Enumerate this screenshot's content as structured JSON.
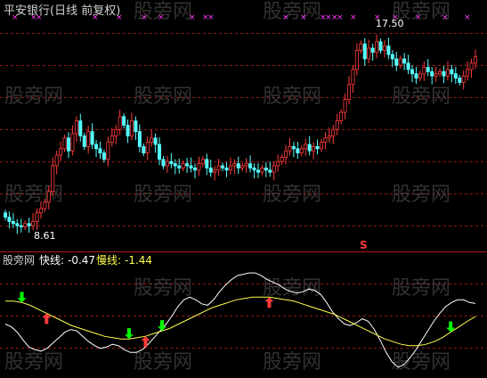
{
  "header": {
    "title": "平安银行(日线 前复权)"
  },
  "price_panel": {
    "high_label": "17.50",
    "low_label": "8.61",
    "marker_symbol": "S",
    "watermark": "股旁网"
  },
  "indicator_panel": {
    "name": "股旁网",
    "fast_label": "快线:",
    "fast_value": "-0.47",
    "slow_label": "慢线:",
    "slow_value": "-1.44"
  },
  "colors": {
    "background": "#000000",
    "up_candle": "#ff3b3b",
    "down_candle": "#54ffff",
    "grid": "#9b1414",
    "separator": "#b01a1a",
    "title": "#d0d0d0",
    "x_marks": "#ff3cff",
    "fast_line": "#ffffff",
    "slow_line": "#ffff4c",
    "buy_arrow": "#00ff00",
    "sell_arrow": "#ff3b3b",
    "watermark": "#5a5a5a"
  },
  "chart_data": [
    {
      "type": "candlestick",
      "title": "平安银行(日线 前复权)",
      "ylim": [
        8.0,
        18.5
      ],
      "annotations": [
        "17.50",
        "8.61"
      ],
      "close": [
        9.1,
        8.9,
        8.8,
        8.7,
        8.65,
        8.8,
        8.7,
        8.9,
        9.3,
        9.5,
        9.8,
        10.3,
        11.5,
        12.0,
        12.3,
        12.8,
        12.2,
        13.0,
        13.6,
        12.9,
        12.4,
        13.1,
        12.5,
        12.3,
        12.1,
        11.8,
        12.6,
        12.9,
        13.2,
        13.8,
        13.4,
        12.9,
        13.6,
        13.1,
        12.4,
        12.1,
        12.6,
        12.8,
        12.5,
        11.8,
        11.5,
        11.7,
        11.6,
        11.5,
        11.4,
        11.6,
        11.5,
        11.4,
        11.3,
        11.6,
        11.8,
        11.4,
        11.2,
        11.3,
        11.5,
        11.4,
        11.3,
        11.5,
        11.6,
        11.4,
        11.5,
        11.6,
        11.4,
        11.3,
        11.2,
        11.4,
        11.3,
        11.2,
        11.5,
        11.7,
        11.9,
        12.2,
        12.4,
        12.3,
        12.1,
        12.3,
        12.5,
        12.2,
        12.4,
        12.3,
        12.6,
        12.8,
        12.9,
        13.2,
        13.6,
        14.0,
        14.6,
        15.3,
        16.0,
        16.9,
        17.2,
        16.5,
        17.0,
        16.8,
        17.3,
        16.9,
        17.1,
        16.7,
        16.5,
        16.2,
        16.5,
        16.3,
        16.0,
        15.8,
        15.6,
        15.8,
        16.1,
        15.9,
        15.7,
        15.8,
        15.9,
        15.7,
        16.0,
        15.8,
        15.6,
        15.4,
        15.7,
        16.0,
        16.3,
        16.6
      ],
      "open": [
        9.3,
        9.1,
        8.9,
        8.8,
        8.7,
        8.65,
        8.8,
        8.7,
        8.9,
        9.3,
        9.5,
        9.8,
        10.3,
        11.5,
        12.0,
        12.3,
        12.8,
        12.2,
        13.0,
        13.6,
        12.9,
        12.4,
        13.1,
        12.5,
        12.3,
        12.1,
        11.8,
        12.6,
        12.9,
        13.2,
        13.8,
        13.4,
        12.9,
        13.6,
        13.1,
        12.4,
        12.1,
        12.6,
        12.8,
        12.5,
        11.8,
        11.5,
        11.7,
        11.6,
        11.5,
        11.4,
        11.6,
        11.5,
        11.4,
        11.3,
        11.6,
        11.8,
        11.4,
        11.2,
        11.3,
        11.5,
        11.4,
        11.3,
        11.5,
        11.6,
        11.4,
        11.5,
        11.6,
        11.4,
        11.3,
        11.2,
        11.4,
        11.3,
        11.2,
        11.5,
        11.7,
        11.9,
        12.2,
        12.4,
        12.3,
        12.1,
        12.3,
        12.5,
        12.2,
        12.4,
        12.3,
        12.6,
        12.8,
        12.9,
        13.2,
        13.6,
        14.0,
        14.6,
        15.3,
        16.0,
        16.9,
        17.2,
        16.5,
        17.0,
        16.8,
        17.3,
        16.9,
        17.1,
        16.7,
        16.5,
        16.2,
        16.5,
        16.3,
        16.0,
        15.8,
        15.6,
        15.8,
        16.1,
        15.9,
        15.7,
        15.8,
        15.9,
        15.7,
        16.0,
        15.8,
        15.6,
        15.4,
        15.7,
        16.0,
        16.3
      ]
    },
    {
      "type": "line",
      "series": [
        {
          "name": "快线",
          "values": [
            -2.0,
            -2.2,
            -2.6,
            -3.2,
            -3.7,
            -3.9,
            -4.0,
            -3.8,
            -3.4,
            -3.0,
            -2.6,
            -2.4,
            -2.5,
            -2.9,
            -3.3,
            -3.6,
            -3.8,
            -3.7,
            -3.5,
            -3.6,
            -3.9,
            -4.1,
            -4.1,
            -3.9,
            -3.5,
            -3.0,
            -2.5,
            -2.0,
            -1.4,
            -0.7,
            -0.2,
            0.0,
            -0.2,
            -0.5,
            -0.6,
            -0.2,
            0.4,
            0.9,
            1.3,
            1.6,
            1.7,
            1.8,
            1.8,
            1.6,
            1.3,
            1.1,
            0.9,
            0.6,
            0.4,
            0.3,
            0.4,
            0.6,
            0.5,
            0.2,
            -0.4,
            -1.1,
            -1.6,
            -2.0,
            -2.1,
            -1.9,
            -1.6,
            -1.8,
            -2.4,
            -3.2,
            -4.1,
            -4.8,
            -5.2,
            -5.0,
            -4.5,
            -3.9,
            -3.2,
            -2.5,
            -1.8,
            -1.2,
            -0.7,
            -0.4,
            -0.2,
            -0.2,
            -0.4,
            -0.47
          ]
        },
        {
          "name": "慢线",
          "values": [
            -0.3,
            -0.3,
            -0.4,
            -0.6,
            -0.9,
            -1.2,
            -1.5,
            -1.8,
            -2.1,
            -2.3,
            -2.5,
            -2.7,
            -2.9,
            -3.0,
            -3.1,
            -3.1,
            -3.0,
            -2.9,
            -2.7,
            -2.5,
            -2.3,
            -2.0,
            -1.7,
            -1.4,
            -1.1,
            -0.8,
            -0.6,
            -0.4,
            -0.2,
            -0.1,
            -0.0,
            0.0,
            0.0,
            -0.1,
            -0.2,
            -0.3,
            -0.5,
            -0.7,
            -0.9,
            -1.1,
            -1.3,
            -1.6,
            -1.9,
            -2.2,
            -2.5,
            -2.8,
            -3.1,
            -3.3,
            -3.5,
            -3.6,
            -3.6,
            -3.5,
            -3.3,
            -3.0,
            -2.6,
            -2.2,
            -1.8,
            -1.44
          ]
        }
      ],
      "signals": {
        "buy": [
          4,
          27,
          33,
          95
        ],
        "sell": [
          8,
          30,
          57
        ]
      }
    }
  ]
}
